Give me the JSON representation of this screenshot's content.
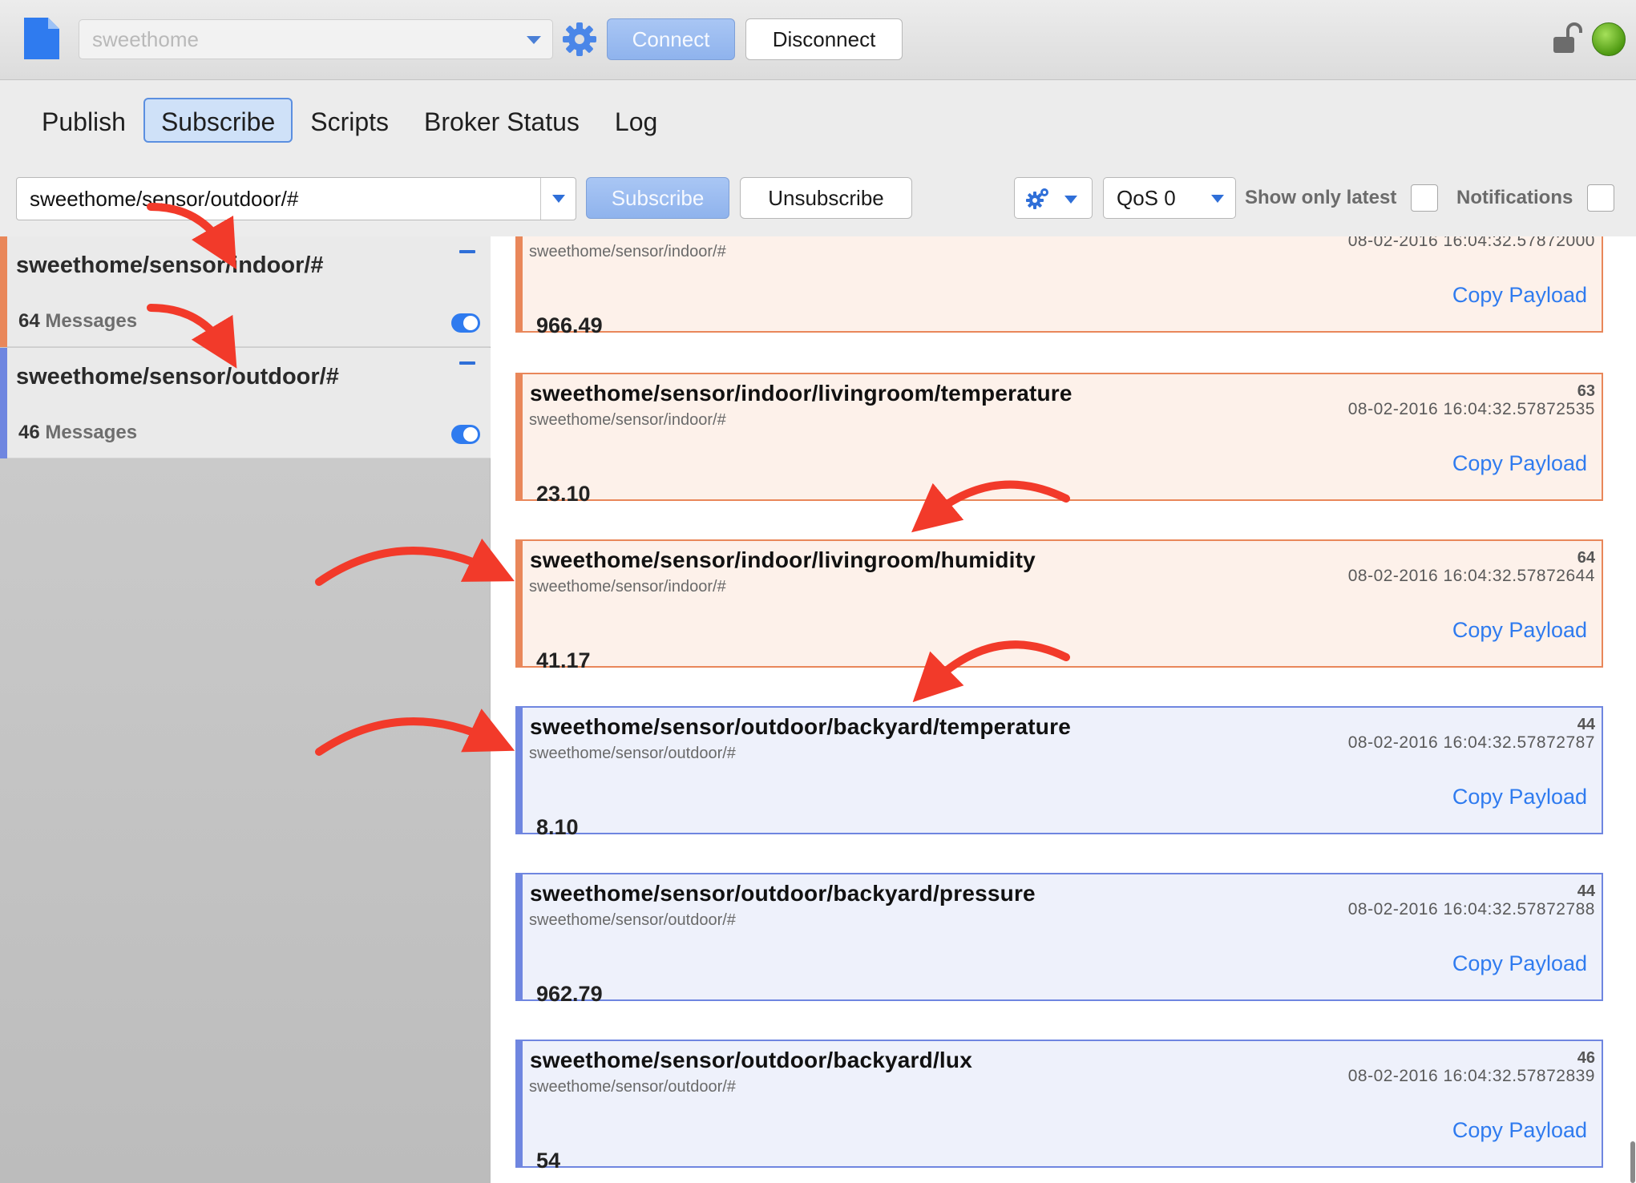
{
  "toolbar": {
    "broker": "sweethome",
    "connect_label": "Connect",
    "disconnect_label": "Disconnect"
  },
  "tabs": [
    {
      "label": "Publish"
    },
    {
      "label": "Subscribe",
      "active": true
    },
    {
      "label": "Scripts"
    },
    {
      "label": "Broker Status"
    },
    {
      "label": "Log"
    }
  ],
  "subscribe_bar": {
    "topic_value": "sweethome/sensor/outdoor/#",
    "subscribe_label": "Subscribe",
    "unsubscribe_label": "Unsubscribe",
    "qos_value": "QoS 0",
    "show_only_latest_label": "Show only latest",
    "notifications_label": "Notifications"
  },
  "subscriptions": [
    {
      "topic": "sweethome/sensor/indoor/#",
      "count": "64",
      "count_suffix": "Messages",
      "color": "#e9875a",
      "enabled": true
    },
    {
      "topic": "sweethome/sensor/outdoor/#",
      "count": "46",
      "count_suffix": "Messages",
      "color": "#6f86e0",
      "enabled": true
    }
  ],
  "messages": [
    {
      "topic": "",
      "subscription": "sweethome/sensor/indoor/#",
      "number": "",
      "timestamp": "08-02-2016  16:04:32.57872000",
      "copy_label": "Copy Payload",
      "payload": "966.49",
      "kind": "indoor"
    },
    {
      "topic": "sweethome/sensor/indoor/livingroom/temperature",
      "subscription": "sweethome/sensor/indoor/#",
      "number": "63",
      "timestamp": "08-02-2016  16:04:32.57872535",
      "copy_label": "Copy Payload",
      "payload": "23.10",
      "kind": "indoor"
    },
    {
      "topic": "sweethome/sensor/indoor/livingroom/humidity",
      "subscription": "sweethome/sensor/indoor/#",
      "number": "64",
      "timestamp": "08-02-2016  16:04:32.57872644",
      "copy_label": "Copy Payload",
      "payload": "41.17",
      "kind": "indoor"
    },
    {
      "topic": "sweethome/sensor/outdoor/backyard/temperature",
      "subscription": "sweethome/sensor/outdoor/#",
      "number": "44",
      "timestamp": "08-02-2016  16:04:32.57872787",
      "copy_label": "Copy Payload",
      "payload": "8.10",
      "kind": "outdoor"
    },
    {
      "topic": "sweethome/sensor/outdoor/backyard/pressure",
      "subscription": "sweethome/sensor/outdoor/#",
      "number": "44",
      "timestamp": "08-02-2016  16:04:32.57872788",
      "copy_label": "Copy Payload",
      "payload": "962.79",
      "kind": "outdoor"
    },
    {
      "topic": "sweethome/sensor/outdoor/backyard/lux",
      "subscription": "sweethome/sensor/outdoor/#",
      "number": "46",
      "timestamp": "08-02-2016  16:04:32.57872839",
      "copy_label": "Copy Payload",
      "payload": "54",
      "kind": "outdoor"
    }
  ],
  "icons": {
    "document": "document-icon",
    "settings": "gear-icon",
    "lock": "unlocked-padlock-icon",
    "status": "connection-status-icon",
    "annotation": "red-arrow-annotation-icon"
  },
  "colors": {
    "accent": "#2f7bef",
    "indoor": "#e9875a",
    "outdoor": "#6f86e0",
    "annotation_arrow": "#f23a2a",
    "connected": "#5aa81c"
  }
}
